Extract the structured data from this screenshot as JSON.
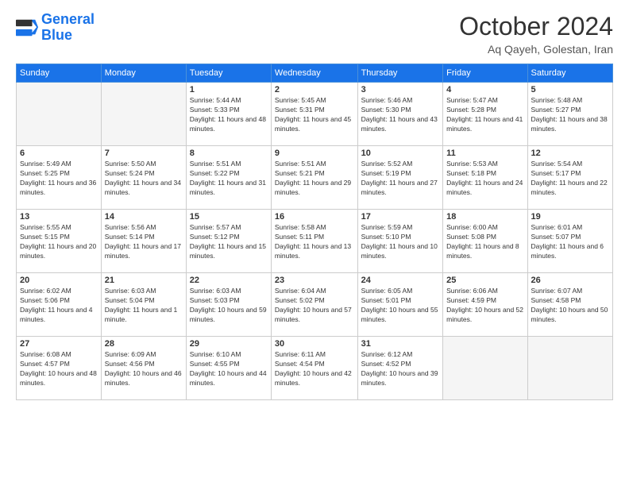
{
  "header": {
    "logo_line1": "General",
    "logo_line2": "Blue",
    "month": "October 2024",
    "location": "Aq Qayeh, Golestan, Iran"
  },
  "weekdays": [
    "Sunday",
    "Monday",
    "Tuesday",
    "Wednesday",
    "Thursday",
    "Friday",
    "Saturday"
  ],
  "weeks": [
    [
      {
        "day": "",
        "detail": ""
      },
      {
        "day": "",
        "detail": ""
      },
      {
        "day": "1",
        "detail": "Sunrise: 5:44 AM\nSunset: 5:33 PM\nDaylight: 11 hours and 48 minutes."
      },
      {
        "day": "2",
        "detail": "Sunrise: 5:45 AM\nSunset: 5:31 PM\nDaylight: 11 hours and 45 minutes."
      },
      {
        "day": "3",
        "detail": "Sunrise: 5:46 AM\nSunset: 5:30 PM\nDaylight: 11 hours and 43 minutes."
      },
      {
        "day": "4",
        "detail": "Sunrise: 5:47 AM\nSunset: 5:28 PM\nDaylight: 11 hours and 41 minutes."
      },
      {
        "day": "5",
        "detail": "Sunrise: 5:48 AM\nSunset: 5:27 PM\nDaylight: 11 hours and 38 minutes."
      }
    ],
    [
      {
        "day": "6",
        "detail": "Sunrise: 5:49 AM\nSunset: 5:25 PM\nDaylight: 11 hours and 36 minutes."
      },
      {
        "day": "7",
        "detail": "Sunrise: 5:50 AM\nSunset: 5:24 PM\nDaylight: 11 hours and 34 minutes."
      },
      {
        "day": "8",
        "detail": "Sunrise: 5:51 AM\nSunset: 5:22 PM\nDaylight: 11 hours and 31 minutes."
      },
      {
        "day": "9",
        "detail": "Sunrise: 5:51 AM\nSunset: 5:21 PM\nDaylight: 11 hours and 29 minutes."
      },
      {
        "day": "10",
        "detail": "Sunrise: 5:52 AM\nSunset: 5:19 PM\nDaylight: 11 hours and 27 minutes."
      },
      {
        "day": "11",
        "detail": "Sunrise: 5:53 AM\nSunset: 5:18 PM\nDaylight: 11 hours and 24 minutes."
      },
      {
        "day": "12",
        "detail": "Sunrise: 5:54 AM\nSunset: 5:17 PM\nDaylight: 11 hours and 22 minutes."
      }
    ],
    [
      {
        "day": "13",
        "detail": "Sunrise: 5:55 AM\nSunset: 5:15 PM\nDaylight: 11 hours and 20 minutes."
      },
      {
        "day": "14",
        "detail": "Sunrise: 5:56 AM\nSunset: 5:14 PM\nDaylight: 11 hours and 17 minutes."
      },
      {
        "day": "15",
        "detail": "Sunrise: 5:57 AM\nSunset: 5:12 PM\nDaylight: 11 hours and 15 minutes."
      },
      {
        "day": "16",
        "detail": "Sunrise: 5:58 AM\nSunset: 5:11 PM\nDaylight: 11 hours and 13 minutes."
      },
      {
        "day": "17",
        "detail": "Sunrise: 5:59 AM\nSunset: 5:10 PM\nDaylight: 11 hours and 10 minutes."
      },
      {
        "day": "18",
        "detail": "Sunrise: 6:00 AM\nSunset: 5:08 PM\nDaylight: 11 hours and 8 minutes."
      },
      {
        "day": "19",
        "detail": "Sunrise: 6:01 AM\nSunset: 5:07 PM\nDaylight: 11 hours and 6 minutes."
      }
    ],
    [
      {
        "day": "20",
        "detail": "Sunrise: 6:02 AM\nSunset: 5:06 PM\nDaylight: 11 hours and 4 minutes."
      },
      {
        "day": "21",
        "detail": "Sunrise: 6:03 AM\nSunset: 5:04 PM\nDaylight: 11 hours and 1 minute."
      },
      {
        "day": "22",
        "detail": "Sunrise: 6:03 AM\nSunset: 5:03 PM\nDaylight: 10 hours and 59 minutes."
      },
      {
        "day": "23",
        "detail": "Sunrise: 6:04 AM\nSunset: 5:02 PM\nDaylight: 10 hours and 57 minutes."
      },
      {
        "day": "24",
        "detail": "Sunrise: 6:05 AM\nSunset: 5:01 PM\nDaylight: 10 hours and 55 minutes."
      },
      {
        "day": "25",
        "detail": "Sunrise: 6:06 AM\nSunset: 4:59 PM\nDaylight: 10 hours and 52 minutes."
      },
      {
        "day": "26",
        "detail": "Sunrise: 6:07 AM\nSunset: 4:58 PM\nDaylight: 10 hours and 50 minutes."
      }
    ],
    [
      {
        "day": "27",
        "detail": "Sunrise: 6:08 AM\nSunset: 4:57 PM\nDaylight: 10 hours and 48 minutes."
      },
      {
        "day": "28",
        "detail": "Sunrise: 6:09 AM\nSunset: 4:56 PM\nDaylight: 10 hours and 46 minutes."
      },
      {
        "day": "29",
        "detail": "Sunrise: 6:10 AM\nSunset: 4:55 PM\nDaylight: 10 hours and 44 minutes."
      },
      {
        "day": "30",
        "detail": "Sunrise: 6:11 AM\nSunset: 4:54 PM\nDaylight: 10 hours and 42 minutes."
      },
      {
        "day": "31",
        "detail": "Sunrise: 6:12 AM\nSunset: 4:52 PM\nDaylight: 10 hours and 39 minutes."
      },
      {
        "day": "",
        "detail": ""
      },
      {
        "day": "",
        "detail": ""
      }
    ]
  ]
}
